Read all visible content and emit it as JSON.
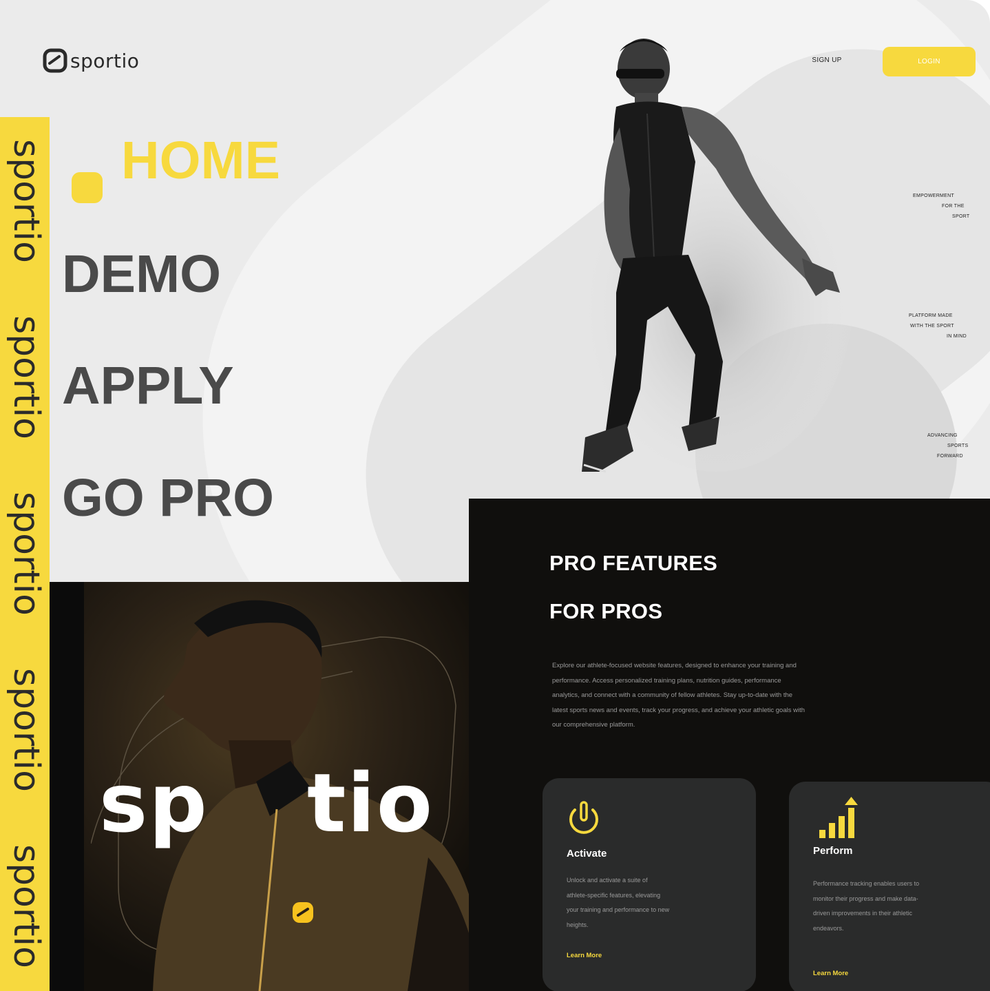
{
  "brand": {
    "name": "sportio"
  },
  "header": {
    "signup_label": "SIGN UP",
    "login_label": "LOGIN"
  },
  "nav": {
    "items": [
      {
        "label": "HOME",
        "active": true
      },
      {
        "label": "DEMO"
      },
      {
        "label": "APPLY"
      },
      {
        "label": "GO PRO"
      }
    ]
  },
  "hero_tags": [
    {
      "lines": [
        "EMPOWERMENT",
        "FOR THE",
        "SPORT"
      ]
    },
    {
      "lines": [
        "PLATFORM MADE",
        "WITH THE SPORT",
        "IN MIND"
      ]
    },
    {
      "lines": [
        "ADVANCING",
        "SPORTS",
        "FORWARD"
      ]
    }
  ],
  "strip_words": [
    "sportio",
    "sportio",
    "sportio",
    "sportio",
    "sportio"
  ],
  "portrait": {
    "brand_visible_start": "sp",
    "brand_visible_end": "tio"
  },
  "features": {
    "title_line_1": "PRO FEATURES",
    "title_line_2": "FOR PROS",
    "description": "Explore our athlete-focused website features, designed to enhance your training and performance. Access personalized training plans, nutrition guides, performance analytics, and connect with a community of fellow athletes. Stay up-to-date with the latest sports news and events, track your progress, and achieve your athletic goals with our comprehensive platform.",
    "cards": [
      {
        "icon": "power-icon",
        "title": "Activate",
        "text": "Unlock and activate a suite of athlete-specific features, elevating your training and performance to new heights.",
        "link": "Learn More"
      },
      {
        "icon": "bar-chart-up-icon",
        "title": "Perform",
        "text": "Performance tracking enables users to monitor their progress and make data-driven improvements in their athletic endeavors.",
        "link": "Learn More"
      }
    ]
  },
  "colors": {
    "accent": "#f7d93e",
    "dark": "#100f0d",
    "card": "#2a2b2b",
    "light": "#ebebeb"
  }
}
